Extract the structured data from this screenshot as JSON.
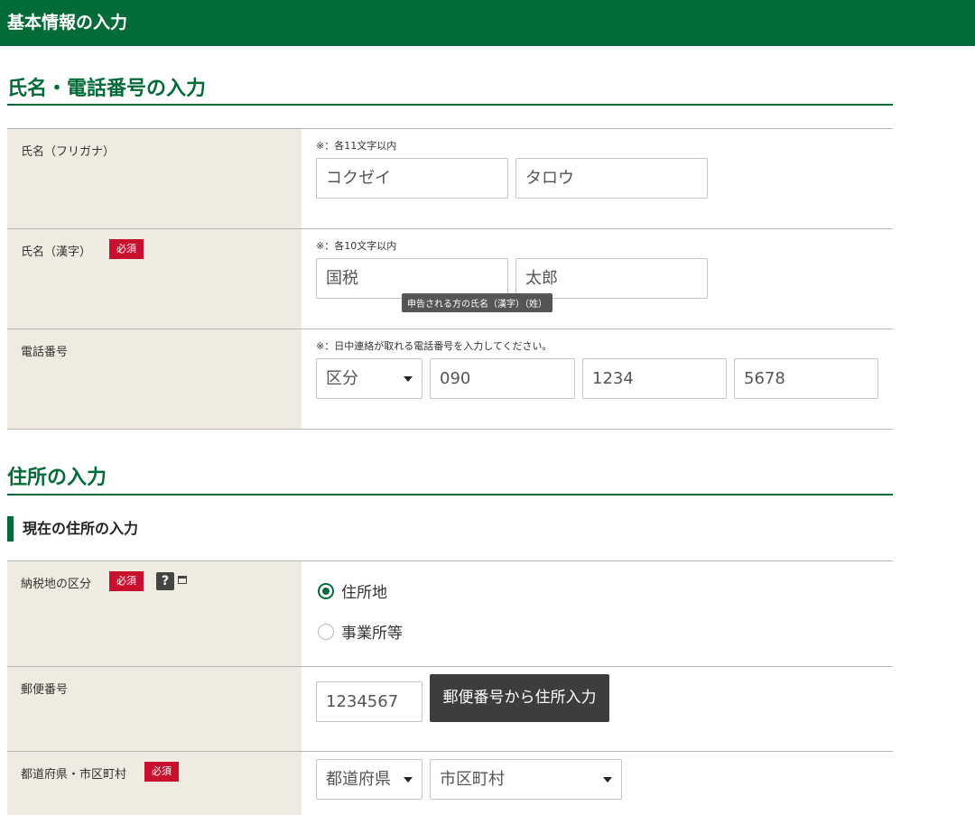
{
  "header": {
    "title": "基本情報の入力"
  },
  "section_name_phone": {
    "title": "氏名・電話番号の入力"
  },
  "kana": {
    "label": "氏名（フリガナ）",
    "note": "※：各11文字以内",
    "last_value": "コクゼイ",
    "first_value": "タロウ"
  },
  "kanji": {
    "label": "氏名（漢字）",
    "required": "必須",
    "note": "※：各10文字以内",
    "last_value": "国税",
    "first_value": "太郎",
    "tooltip": "申告される方の氏名（漢字）（姓）"
  },
  "phone": {
    "label": "電話番号",
    "note": "※：日中連絡が取れる電話番号を入力してください。",
    "type_select": "区分",
    "part1": "090",
    "part2": "1234",
    "part3": "5678"
  },
  "section_address": {
    "title": "住所の入力"
  },
  "current_address": {
    "title": "現在の住所の入力"
  },
  "tax_place": {
    "label": "納税地の区分",
    "required": "必須",
    "help": "?",
    "options": [
      "住所地",
      "事業所等"
    ],
    "selected": "住所地"
  },
  "postal": {
    "label": "郵便番号",
    "value": "1234567",
    "button": "郵便番号から住所入力"
  },
  "prefecture_city": {
    "label": "都道府県・市区町村",
    "required": "必須",
    "prefecture_select": "都道府県",
    "city_select": "市区町村"
  }
}
